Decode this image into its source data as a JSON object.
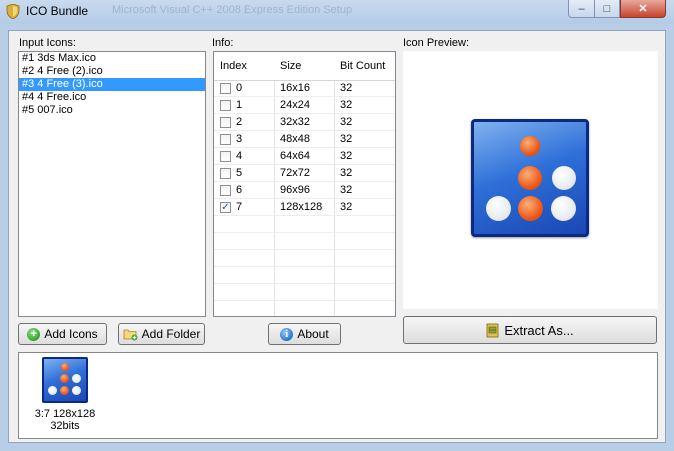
{
  "window": {
    "title": "ICO Bundle",
    "background_title": "Microsoft Visual C++ 2008 Express Edition Setup",
    "min_label": "–",
    "max_label": "□",
    "close_label": "✕"
  },
  "input_icons": {
    "label": "Input Icons:",
    "items": [
      "#1 3ds Max.ico",
      "#2 4 Free (2).ico",
      "#3 4 Free (3).ico",
      "#4 4 Free.ico",
      "#5 007.ico"
    ],
    "selected_index": 2
  },
  "info": {
    "label": "Info:",
    "columns": [
      "Index",
      "Size",
      "Bit Count"
    ],
    "rows": [
      {
        "checked": false,
        "index": "0",
        "size": "16x16",
        "bits": "32"
      },
      {
        "checked": false,
        "index": "1",
        "size": "24x24",
        "bits": "32"
      },
      {
        "checked": false,
        "index": "2",
        "size": "32x32",
        "bits": "32"
      },
      {
        "checked": false,
        "index": "3",
        "size": "48x48",
        "bits": "32"
      },
      {
        "checked": false,
        "index": "4",
        "size": "64x64",
        "bits": "32"
      },
      {
        "checked": false,
        "index": "5",
        "size": "72x72",
        "bits": "32"
      },
      {
        "checked": false,
        "index": "6",
        "size": "96x96",
        "bits": "32"
      },
      {
        "checked": true,
        "index": "7",
        "size": "128x128",
        "bits": "32"
      }
    ],
    "checkmark": "✓"
  },
  "preview": {
    "label": "Icon Preview:"
  },
  "buttons": {
    "add_icons": "Add Icons",
    "add_folder": "Add Folder",
    "about": "About",
    "extract_as": "Extract As..."
  },
  "bundle": {
    "items": [
      {
        "caption_line1": "3:7 128x128",
        "caption_line2": "32bits"
      }
    ]
  },
  "colors": {
    "selection": "#3399ff",
    "icon_blue": "#2f6fd8",
    "icon_orange": "#ee5a18",
    "add_icon_green": "#39a935",
    "about_blue": "#2a7bd1"
  }
}
